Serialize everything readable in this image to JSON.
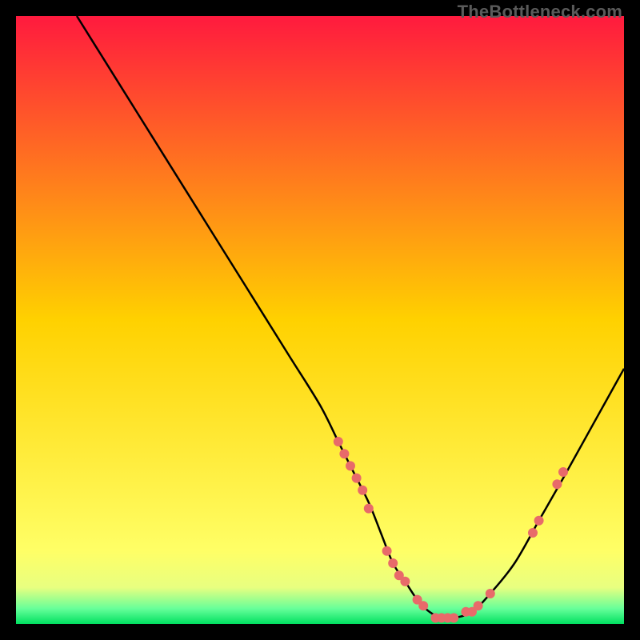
{
  "watermark": "TheBottleneck.com",
  "chart_data": {
    "type": "line",
    "title": "",
    "xlabel": "",
    "ylabel": "",
    "xlim": [
      0,
      100
    ],
    "ylim": [
      0,
      100
    ],
    "grid": false,
    "legend": false,
    "gradient_stops": [
      {
        "offset": 0.0,
        "color": "#ff1a3e"
      },
      {
        "offset": 0.5,
        "color": "#ffd100"
      },
      {
        "offset": 0.88,
        "color": "#ffff66"
      },
      {
        "offset": 0.94,
        "color": "#e8ff80"
      },
      {
        "offset": 0.975,
        "color": "#66ff99"
      },
      {
        "offset": 1.0,
        "color": "#00e060"
      }
    ],
    "series": [
      {
        "name": "bottleneck-curve",
        "color": "#000000",
        "x": [
          10,
          15,
          20,
          25,
          30,
          35,
          40,
          45,
          50,
          53,
          55,
          58,
          60,
          62,
          64,
          66,
          68,
          70,
          72,
          75,
          78,
          82,
          86,
          90,
          95,
          100
        ],
        "y": [
          100,
          92,
          84,
          76,
          68,
          60,
          52,
          44,
          36,
          30,
          26,
          20,
          15,
          10,
          7,
          4,
          2,
          1,
          1,
          2,
          5,
          10,
          17,
          24,
          33,
          42
        ]
      }
    ],
    "scatter_points": {
      "name": "marked-points",
      "color": "#e86a6a",
      "radius": 6,
      "points": [
        {
          "x": 53,
          "y": 30
        },
        {
          "x": 54,
          "y": 28
        },
        {
          "x": 55,
          "y": 26
        },
        {
          "x": 56,
          "y": 24
        },
        {
          "x": 57,
          "y": 22
        },
        {
          "x": 58,
          "y": 19
        },
        {
          "x": 61,
          "y": 12
        },
        {
          "x": 62,
          "y": 10
        },
        {
          "x": 63,
          "y": 8
        },
        {
          "x": 64,
          "y": 7
        },
        {
          "x": 66,
          "y": 4
        },
        {
          "x": 67,
          "y": 3
        },
        {
          "x": 69,
          "y": 1
        },
        {
          "x": 70,
          "y": 1
        },
        {
          "x": 71,
          "y": 1
        },
        {
          "x": 72,
          "y": 1
        },
        {
          "x": 74,
          "y": 2
        },
        {
          "x": 75,
          "y": 2
        },
        {
          "x": 76,
          "y": 3
        },
        {
          "x": 78,
          "y": 5
        },
        {
          "x": 85,
          "y": 15
        },
        {
          "x": 86,
          "y": 17
        },
        {
          "x": 89,
          "y": 23
        },
        {
          "x": 90,
          "y": 25
        }
      ]
    }
  }
}
